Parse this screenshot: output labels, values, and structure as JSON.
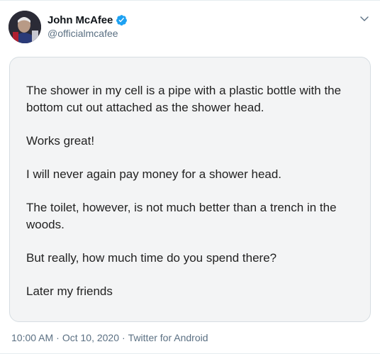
{
  "author": {
    "display_name": "John McAfee",
    "handle": "@officialmcafee",
    "verified": true
  },
  "icons": {
    "verified": "verified-badge-icon",
    "more": "chevron-down-icon"
  },
  "colors": {
    "verified_blue": "#1da1f2",
    "secondary_text": "#5b7083"
  },
  "tweet": {
    "paragraphs": [
      "The shower in my cell is a pipe with a plastic bottle with the bottom cut out attached as the shower head.",
      "Works great!",
      "I will never again pay money for a shower head.",
      "The toilet, however, is not much better than a trench in the woods.",
      "But really, how much time do you spend there?",
      "Later my friends"
    ]
  },
  "meta": {
    "time": "10:00 AM",
    "date": "Oct 10, 2020",
    "source": "Twitter for Android",
    "separator": "·"
  }
}
